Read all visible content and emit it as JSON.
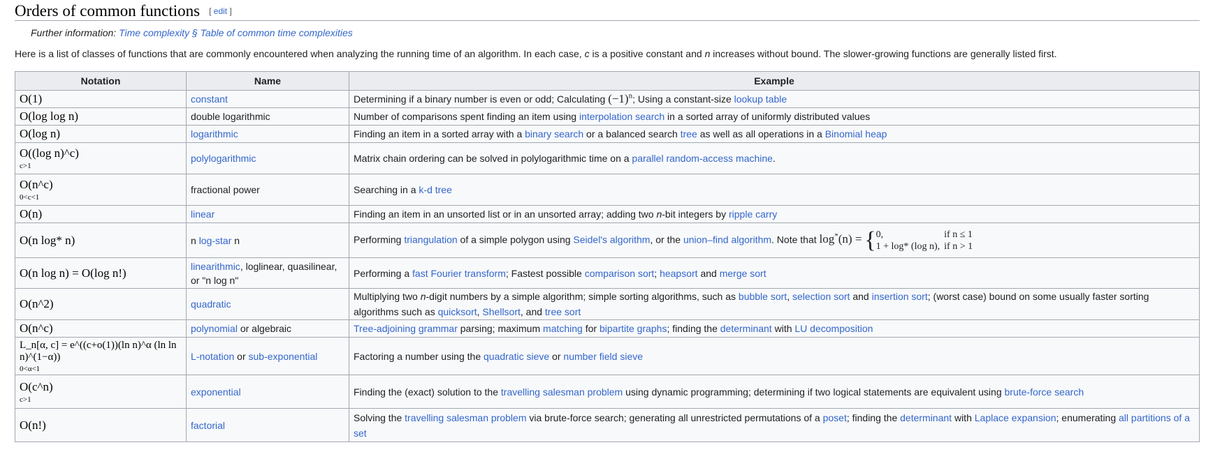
{
  "section": {
    "title": "Orders of common functions",
    "edit_label": "edit"
  },
  "hatnote": {
    "prefix": "Further information: ",
    "link": "Time complexity § Table of common time complexities"
  },
  "intro": {
    "part1": "Here is a list of classes of functions that are commonly encountered when analyzing the running time of an algorithm. In each case, ",
    "c": "c",
    "part2": " is a positive constant and ",
    "n": "n",
    "part3": " increases without bound. The slower-growing functions are generally listed first."
  },
  "table": {
    "headers": [
      "Notation",
      "Name",
      "Example"
    ],
    "rows": [
      {
        "notation": "O(1)",
        "name": "constant"
      },
      {
        "notation": "O(log log n)",
        "name": "double logarithmic"
      },
      {
        "notation": "O(log n)",
        "name": "logarithmic"
      },
      {
        "notation": "O((log n)^c)",
        "notation_cond": "c>1",
        "name": "polylogarithmic"
      },
      {
        "notation": "O(n^c)",
        "notation_cond": "0<c<1",
        "name": "fractional power"
      },
      {
        "notation": "O(n)",
        "name": "linear"
      },
      {
        "notation": "O(n log* n)",
        "name_pre": "n ",
        "name_link": "log-star",
        "name_post": " n"
      },
      {
        "notation": "O(n log n) = O(log n!)",
        "name_link": "linearithmic",
        "name_post": ", loglinear, quasilinear, or \"n log n\""
      },
      {
        "notation": "O(n^2)",
        "name": "quadratic"
      },
      {
        "notation": "O(n^c)",
        "name_link": "polynomial",
        "name_post": " or algebraic"
      },
      {
        "notation": "L_n[α, c] = e^((c+o(1))(ln n)^α (ln ln n)^(1−α))",
        "notation_cond": "0<α<1",
        "name_link": "L-notation",
        "name_mid": " or ",
        "name_link2": "sub-exponential"
      },
      {
        "notation": "O(c^n)",
        "notation_cond": "c>1",
        "name": "exponential"
      },
      {
        "notation": "O(n!)",
        "name": "factorial"
      }
    ],
    "examples": {
      "r0": {
        "t1": "Determining if a binary number is even or odd; Calculating ",
        "math": "(−1)",
        "sup": "n",
        "t2": "; Using a constant-size ",
        "l1": "lookup table"
      },
      "r1": {
        "t1": "Number of comparisons spent finding an item using ",
        "l1": "interpolation search",
        "t2": " in a sorted array of uniformly distributed values"
      },
      "r2": {
        "t1": "Finding an item in a sorted array with a ",
        "l1": "binary search",
        "t2": " or a balanced search ",
        "l2": "tree",
        "t3": " as well as all operations in a ",
        "l3": "Binomial heap"
      },
      "r3": {
        "t1": "Matrix chain ordering can be solved in polylogarithmic time on a ",
        "l1": "parallel random-access machine",
        "t2": "."
      },
      "r4": {
        "t1": "Searching in a ",
        "l1": "k-d tree"
      },
      "r5": {
        "t1": "Finding an item in an unsorted list or in an unsorted array; adding two ",
        "n": "n",
        "t2": "-bit integers by ",
        "l1": "ripple carry"
      },
      "r6": {
        "t1": "Performing ",
        "l1": "triangulation",
        "t2": " of a simple polygon using ",
        "l2": "Seidel's algorithm",
        "t3": ", or the ",
        "l3": "union–find algorithm",
        "t4": ". Note that ",
        "math": "log",
        "mathsup": "*",
        "math2": "(n) =",
        "case1a": "0,",
        "case1b": "if n ≤ 1",
        "case2a": "1 + log* (log n),",
        "case2b": "if n > 1"
      },
      "r7": {
        "t1": "Performing a ",
        "l1": "fast Fourier transform",
        "t2": "; Fastest possible ",
        "l2": "comparison sort",
        "t3": "; ",
        "l3": "heapsort",
        "t4": " and ",
        "l4": "merge sort"
      },
      "r8": {
        "t1": "Multiplying two ",
        "n": "n",
        "t2": "-digit numbers by a simple algorithm; simple sorting algorithms, such as ",
        "l1": "bubble sort",
        "t3": ", ",
        "l2": "selection sort",
        "t4": " and ",
        "l3": "insertion sort",
        "t5": "; (worst case) bound on some usually faster sorting algorithms such as ",
        "l4": "quicksort",
        "t6": ", ",
        "l5": "Shellsort",
        "t7": ", and ",
        "l6": "tree sort"
      },
      "r9": {
        "l1": "Tree-adjoining grammar",
        "t1": " parsing; maximum ",
        "l2": "matching",
        "t2": " for ",
        "l3": "bipartite graphs",
        "t3": "; finding the ",
        "l4": "determinant",
        "t4": " with ",
        "l5": "LU decomposition"
      },
      "r10": {
        "t1": "Factoring a number using the ",
        "l1": "quadratic sieve",
        "t2": " or ",
        "l2": "number field sieve"
      },
      "r11": {
        "t1": "Finding the (exact) solution to the ",
        "l1": "travelling salesman problem",
        "t2": " using ",
        "l2": "dynamic programming",
        "t3": "; determining if two logical statements are equivalent using ",
        "l3": "brute-force search"
      },
      "r12": {
        "t1": "Solving the ",
        "l1": "travelling salesman problem",
        "t2": " via brute-force search; generating all unrestricted permutations of a ",
        "l2": "poset",
        "t3": "; finding the ",
        "l3": "determinant",
        "t4": " with ",
        "l4": "Laplace expansion",
        "t5": "; enumerating ",
        "l5": "all partitions of a set"
      }
    }
  }
}
